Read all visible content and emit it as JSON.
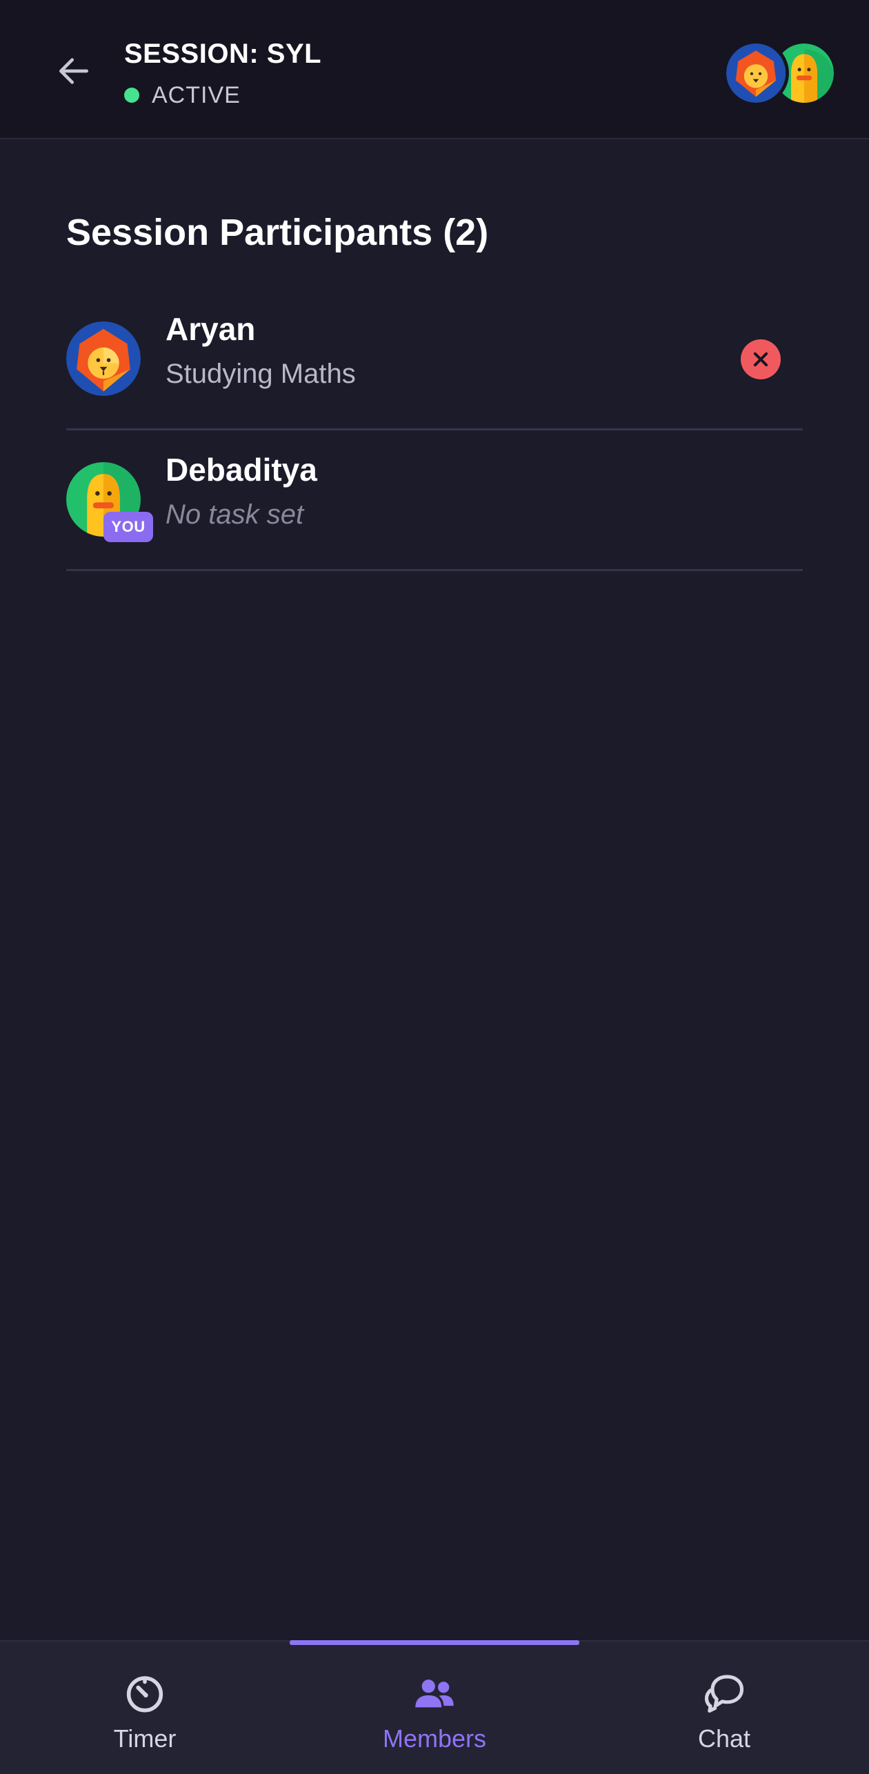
{
  "header": {
    "title": "SESSION: SYL",
    "status": "ACTIVE",
    "status_color": "#45e28f",
    "back_icon": "arrow-left-icon",
    "avatars": [
      "lion-avatar",
      "duck-avatar"
    ]
  },
  "participants": {
    "title": "Session Participants (2)",
    "items": [
      {
        "name": "Aryan",
        "task": "Studying Maths",
        "avatar": "lion-avatar",
        "removable": true
      },
      {
        "name": "Debaditya",
        "task": "No task set",
        "avatar": "duck-avatar",
        "badge": "YOU"
      }
    ]
  },
  "nav": {
    "items": [
      {
        "label": "Timer",
        "icon": "timer-icon"
      },
      {
        "label": "Members",
        "icon": "members-icon",
        "active": true
      },
      {
        "label": "Chat",
        "icon": "chat-icon"
      }
    ],
    "accent": "#8f74f4"
  }
}
